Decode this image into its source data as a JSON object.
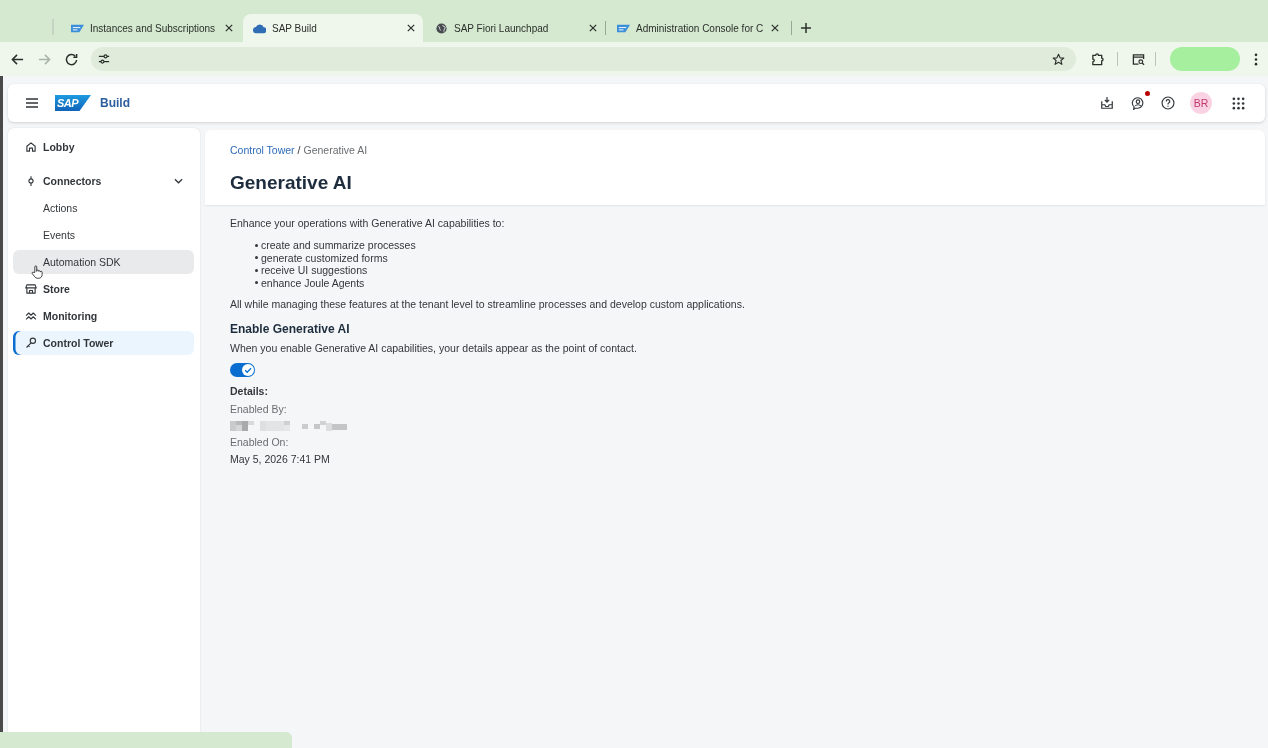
{
  "browser": {
    "tabs": [
      {
        "title": "Instances and Subscriptions",
        "selected": false
      },
      {
        "title": "SAP Build",
        "selected": true
      },
      {
        "title": "SAP Fiori Launchpad",
        "selected": false
      },
      {
        "title": "Administration Console for C",
        "selected": false
      }
    ],
    "forward_disabled": true
  },
  "shell": {
    "logo_text": "SAP",
    "product": "Build",
    "unread_notifications": true,
    "avatar_initials": "BR"
  },
  "sidebar": {
    "items": [
      {
        "label": "Lobby",
        "selected": false,
        "hovered": false
      },
      {
        "label": "Connectors",
        "selected": false,
        "hovered": false,
        "expanded": true,
        "children": [
          {
            "label": "Actions",
            "selected": false,
            "hovered": false
          },
          {
            "label": "Events",
            "selected": false,
            "hovered": false
          },
          {
            "label": "Automation SDK",
            "selected": false,
            "hovered": true
          }
        ]
      },
      {
        "label": "Store",
        "selected": false,
        "hovered": false
      },
      {
        "label": "Monitoring",
        "selected": false,
        "hovered": false
      },
      {
        "label": "Control Tower",
        "selected": true,
        "hovered": false
      }
    ]
  },
  "content": {
    "breadcrumb": [
      {
        "label": "Control Tower",
        "link": true
      },
      {
        "label": "Generative AI",
        "link": false
      }
    ],
    "breadcrumb_separator": "/",
    "title": "Generative AI",
    "intro": "Enhance your operations with Generative AI capabilities to:",
    "capabilities": [
      "create and summarize processes",
      "generate customized forms",
      "receive UI suggestions",
      "enhance Joule Agents"
    ],
    "summary": "All while managing these features at the tenant level to streamline processes and develop custom applications.",
    "section": {
      "title": "Enable Generative AI",
      "description": "When you enable Generative AI capabilities, your details appear as the point of contact.",
      "toggle": {
        "on": true
      }
    },
    "details": {
      "heading": "Details:",
      "fields": [
        {
          "label": "Enabled By:",
          "redacted": true
        },
        {
          "label": "Enabled On:",
          "redacted": false,
          "value": "May 5, 2026 7:41 PM"
        }
      ]
    }
  }
}
